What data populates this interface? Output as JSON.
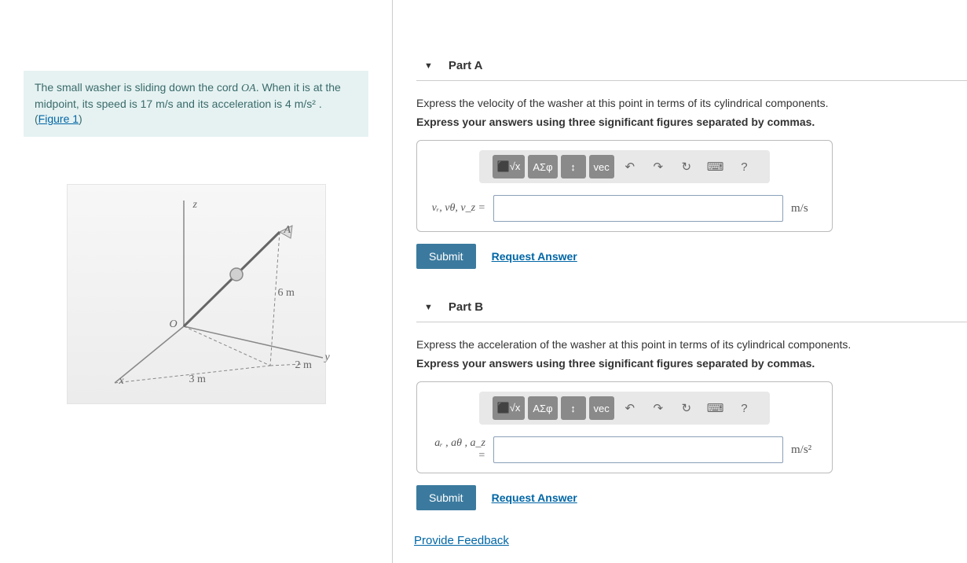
{
  "problem": {
    "text_pre": "The small washer is sliding down the cord ",
    "OA": "OA",
    "text_mid": ". When it is at the midpoint, its speed is 17  m/s and its acceleration is 4  m/s² . (",
    "figure_link": "Figure 1",
    "text_post": ")"
  },
  "figure": {
    "z": "z",
    "A": "A",
    "O": "O",
    "y": "y",
    "x": "x",
    "d6m": "6 m",
    "d2m": "2 m",
    "d3m": "3 m"
  },
  "parts": [
    {
      "title": "Part A",
      "instr1": "Express the velocity of the washer at this point in terms of its cylindrical components.",
      "instr2": "Express your answers using three significant figures separated by commas.",
      "var_label": "vᵣ, vθ, v_z =",
      "unit": "m/s",
      "submit": "Submit",
      "request": "Request Answer"
    },
    {
      "title": "Part B",
      "instr1": "Express the acceleration of the washer at this point in terms of its cylindrical components.",
      "instr2": "Express your answers using three significant figures separated by commas.",
      "var_label": "aᵣ , aθ , a_z =",
      "unit": "m/s²",
      "submit": "Submit",
      "request": "Request Answer"
    }
  ],
  "toolbar": {
    "templates": "⬛√x",
    "greek": "ΑΣφ",
    "updown": "↕",
    "vec": "vec",
    "undo": "↶",
    "redo": "↷",
    "reset": "↻",
    "keyboard": "⌨",
    "help": "?"
  },
  "feedback": "Provide Feedback"
}
